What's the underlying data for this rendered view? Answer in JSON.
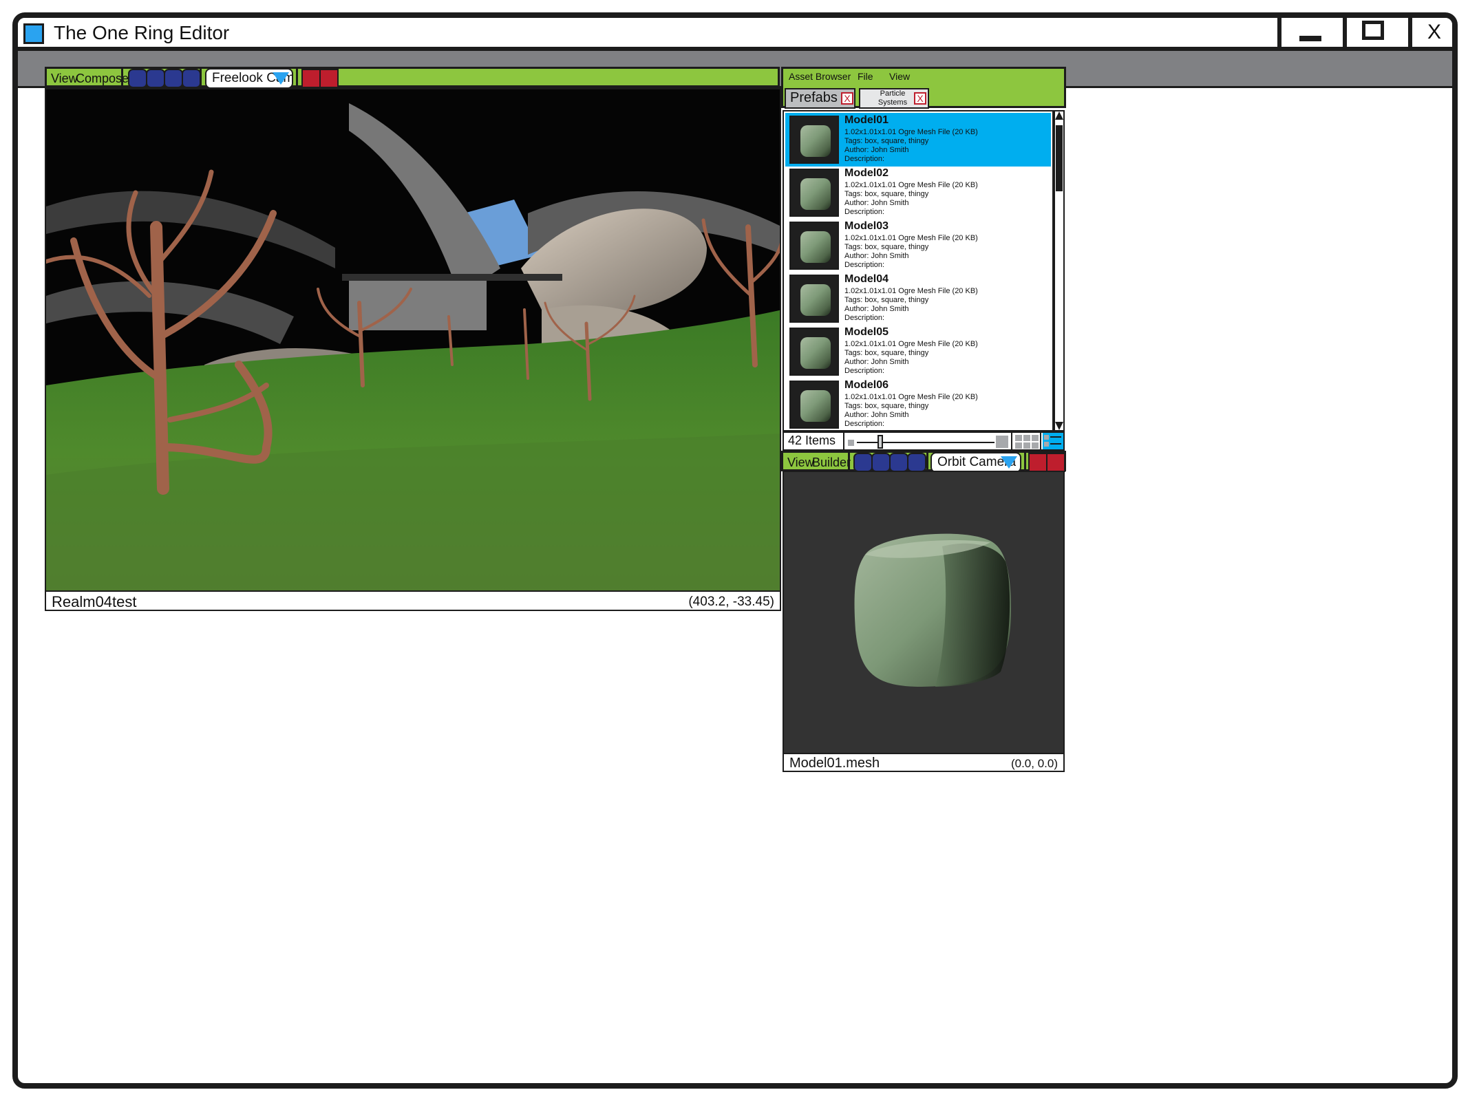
{
  "window": {
    "title": "The One Ring Editor",
    "minimize_icon": "minimize-icon",
    "maximize_icon": "maximize-icon",
    "close_label": "X"
  },
  "composer": {
    "view_label": "View",
    "mode_label": "Composer",
    "camera": "Freelook Camera",
    "scene_name": "Realm04test",
    "coordinates": "(403.2, -33.45)"
  },
  "asset_browser": {
    "title": "Asset Browser",
    "menu_file": "File",
    "menu_view": "View",
    "tabs": [
      {
        "label": "Prefabs",
        "close": "X"
      },
      {
        "label": "Particle Systems",
        "close": "X"
      }
    ],
    "items": [
      {
        "name": "Model01",
        "info": "1.02x1.01x1.01 Ogre Mesh File (20 KB)",
        "tags": "Tags: box, square, thingy",
        "author": "Author: John Smith",
        "description": "Description:"
      },
      {
        "name": "Model02",
        "info": "1.02x1.01x1.01 Ogre Mesh File (20 KB)",
        "tags": "Tags: box, square, thingy",
        "author": "Author: John Smith",
        "description": "Description:"
      },
      {
        "name": "Model03",
        "info": "1.02x1.01x1.01 Ogre Mesh File (20 KB)",
        "tags": "Tags: box, square, thingy",
        "author": "Author: John Smith",
        "description": "Description:"
      },
      {
        "name": "Model04",
        "info": "1.02x1.01x1.01 Ogre Mesh File (20 KB)",
        "tags": "Tags: box, square, thingy",
        "author": "Author: John Smith",
        "description": "Description:"
      },
      {
        "name": "Model05",
        "info": "1.02x1.01x1.01 Ogre Mesh File (20 KB)",
        "tags": "Tags: box, square, thingy",
        "author": "Author: John Smith",
        "description": "Description:"
      },
      {
        "name": "Model06",
        "info": "1.02x1.01x1.01 Ogre Mesh File (20 KB)",
        "tags": "Tags: box, square, thingy",
        "author": "Author: John Smith",
        "description": "Description:"
      }
    ],
    "selected_index": 0,
    "item_count": "42 Items",
    "zoom_level": 0.18
  },
  "builder": {
    "view_label": "View",
    "mode_label": "Builder",
    "camera": "Orbit Camera",
    "mesh_name": "Model01.mesh",
    "coordinates": "(0.0, 0.0)"
  },
  "colors": {
    "toolbar_green": "#8dc63f",
    "selection_blue": "#00aeef",
    "round_button": "#2b3990",
    "square_button": "#be1e2d",
    "menubar_gray": "#808184"
  }
}
